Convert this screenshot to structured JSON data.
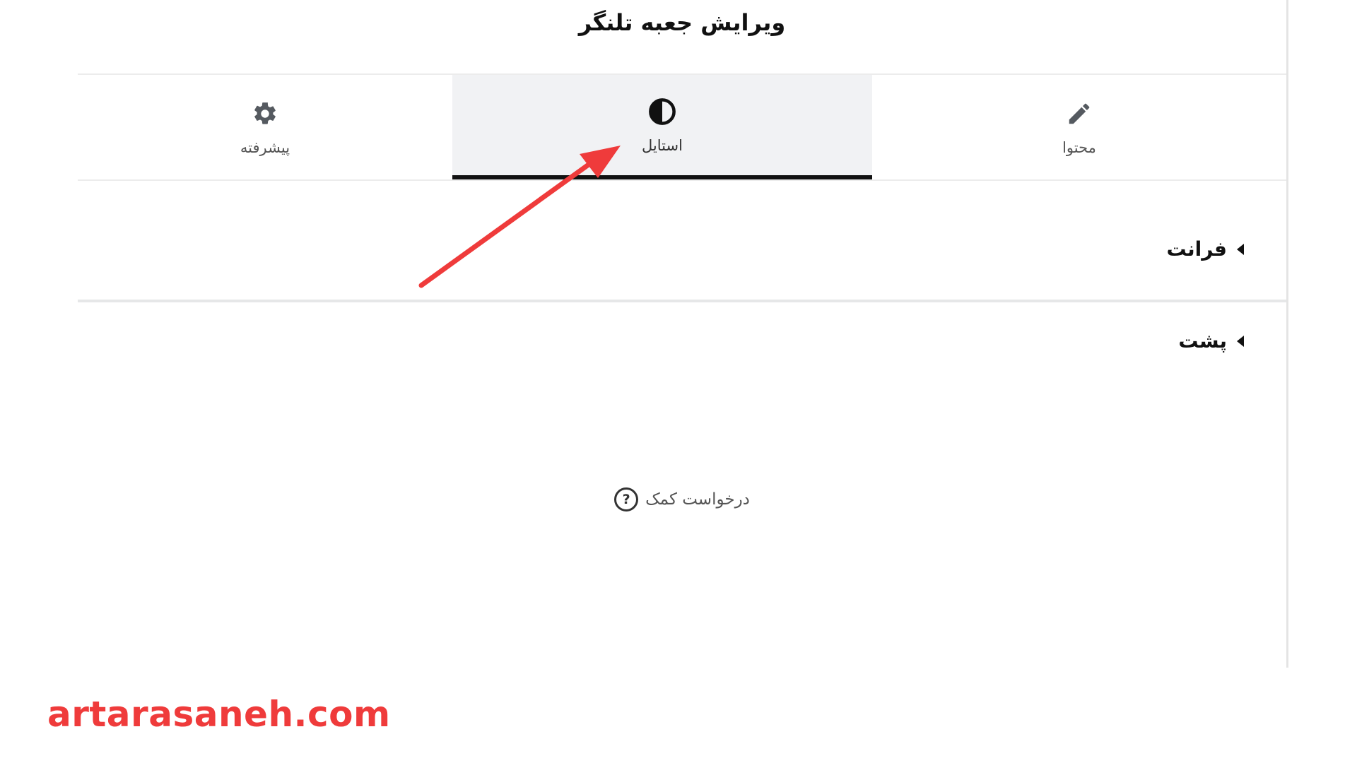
{
  "panel": {
    "title": "ویرایش جعبه تلنگر"
  },
  "tabs": [
    {
      "id": "advanced",
      "label": "پیشرفته",
      "icon": "gear-icon",
      "active": false
    },
    {
      "id": "style",
      "label": "استایل",
      "icon": "contrast-icon",
      "active": true
    },
    {
      "id": "content",
      "label": "محتوا",
      "icon": "pencil-icon",
      "active": false
    }
  ],
  "sections": {
    "front": {
      "label": "فرانت",
      "icon": "caret-left-icon"
    },
    "back": {
      "label": "پشت",
      "icon": "caret-left-icon"
    }
  },
  "help": {
    "label": "درخواست کمک",
    "icon": "question-circle-icon"
  },
  "watermark": {
    "text": "artarasaneh.com"
  },
  "colors": {
    "active_tab_bg": "#f1f2f4",
    "active_tab_underline": "#111111",
    "annotation_arrow": "#ef3b3b",
    "watermark": "#ef3b3b"
  }
}
